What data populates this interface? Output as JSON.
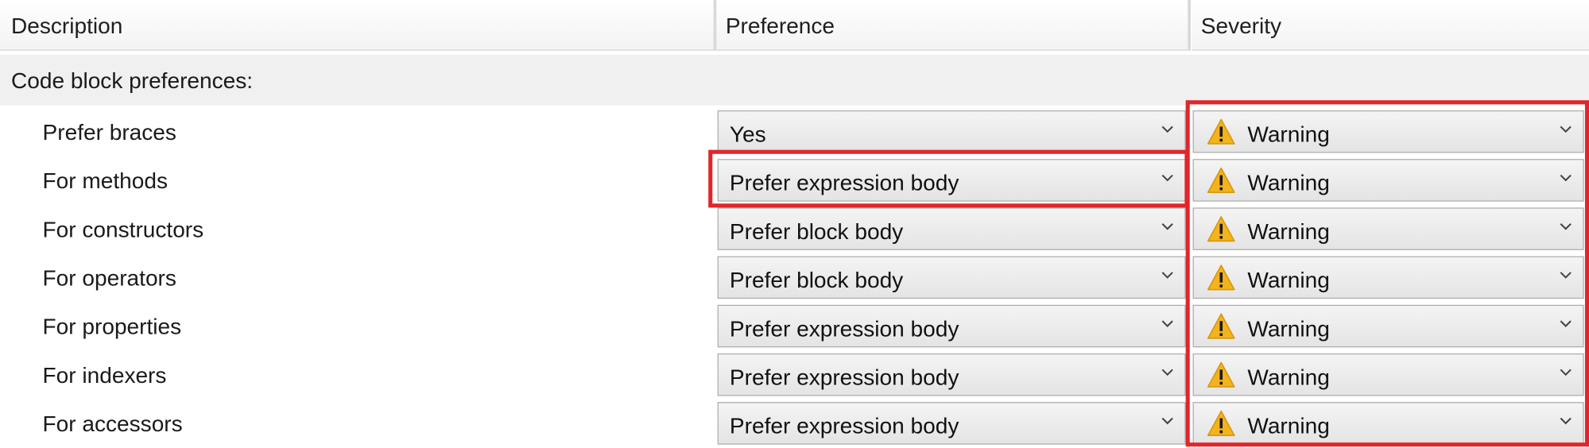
{
  "columns": {
    "description": "Description",
    "preference": "Preference",
    "severity": "Severity"
  },
  "group": {
    "label": "Code block preferences:"
  },
  "rows": [
    {
      "description": "Prefer braces",
      "preference": "Yes",
      "severity": "Warning"
    },
    {
      "description": "For methods",
      "preference": "Prefer expression body",
      "severity": "Warning"
    },
    {
      "description": "For constructors",
      "preference": "Prefer block body",
      "severity": "Warning"
    },
    {
      "description": "For operators",
      "preference": "Prefer block body",
      "severity": "Warning"
    },
    {
      "description": "For properties",
      "preference": "Prefer expression body",
      "severity": "Warning"
    },
    {
      "description": "For indexers",
      "preference": "Prefer expression body",
      "severity": "Warning"
    },
    {
      "description": "For accessors",
      "preference": "Prefer expression body",
      "severity": "Warning"
    }
  ],
  "icons": {
    "severity": "warning-triangle-icon",
    "dropdown": "chevron-down-icon"
  },
  "colors": {
    "highlight": "#e1262b",
    "warning_fill": "#f2b31c"
  }
}
